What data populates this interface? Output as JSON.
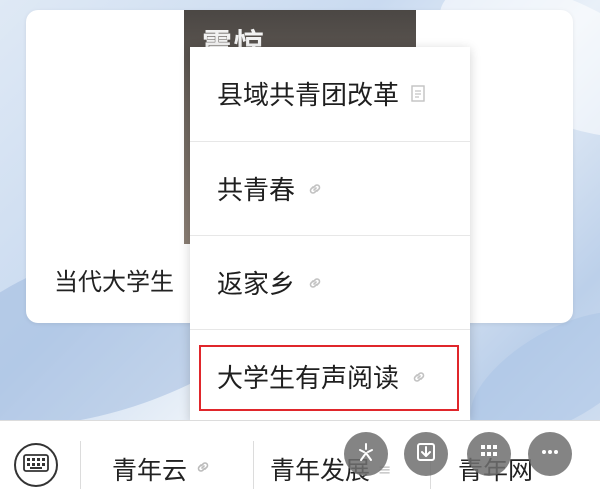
{
  "card": {
    "image_text": "震惊",
    "title": "当代大学生"
  },
  "menu": {
    "items": [
      {
        "label": "县域共青团改革",
        "icon": "document-icon"
      },
      {
        "label": "共青春",
        "icon": "link-icon"
      },
      {
        "label": "返家乡",
        "icon": "link-icon"
      },
      {
        "label": "大学生有声阅读",
        "icon": "link-icon"
      }
    ],
    "highlighted_index": 3
  },
  "bottom_bar": {
    "tabs": [
      {
        "label": "青年云",
        "icon": "link-icon"
      },
      {
        "label": "青年发展",
        "icon": "menu-lines-icon"
      },
      {
        "label": "青年网",
        "icon": ""
      }
    ]
  },
  "floating_buttons": [
    "sparkle-icon",
    "download-icon",
    "grid-icon",
    "more-icon"
  ],
  "colors": {
    "highlight": "#e0262b",
    "fab": "#6e6e6e"
  }
}
